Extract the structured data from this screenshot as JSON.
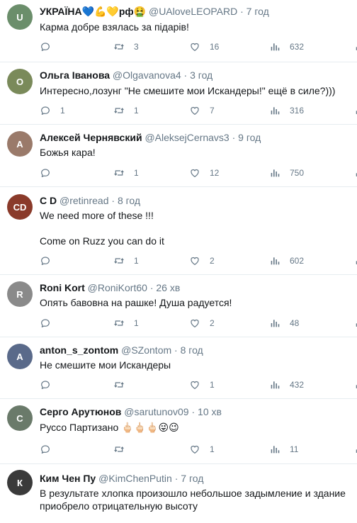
{
  "tweets": [
    {
      "name": "УКРАЇНА💙💪💛рф🤮",
      "handle": "@UAloveLEOPARD",
      "time": "7 год",
      "text": [
        "Карма добре взялась за підарів!"
      ],
      "replies": "",
      "retweets": "3",
      "likes": "16",
      "views": "632",
      "avatar_color": "#6b8e6b"
    },
    {
      "name": "Ольга Іванова",
      "handle": "@Olgavanova4",
      "time": "3 год",
      "text": [
        "Интересно,лозунг \"Не смешите мои Искандеры!\" ещё в силе?)))"
      ],
      "replies": "1",
      "retweets": "1",
      "likes": "7",
      "views": "316",
      "avatar_color": "#7a8a5a"
    },
    {
      "name": "Алексей Чернявский",
      "handle": "@AleksejCernavs3",
      "time": "9 год",
      "text": [
        "Божья кара!"
      ],
      "replies": "",
      "retweets": "1",
      "likes": "12",
      "views": "750",
      "avatar_color": "#9a7a6a"
    },
    {
      "name": "C D",
      "handle": "@retinread",
      "time": "8 год",
      "text": [
        "We need more of these !!!",
        "Come on Ruzz you can do it"
      ],
      "replies": "",
      "retweets": "1",
      "likes": "2",
      "views": "602",
      "avatar_color": "#8a3a2a"
    },
    {
      "name": "Roni Kort",
      "handle": "@RoniKort60",
      "time": "26 хв",
      "text": [
        "Опять бавовна на рашке! Душа радуется!"
      ],
      "replies": "",
      "retweets": "1",
      "likes": "2",
      "views": "48",
      "avatar_color": "#8a8a8a"
    },
    {
      "name": "anton_s_zontom",
      "handle": "@SZontom",
      "time": "8 год",
      "text": [
        "Не смешите мои Искандеры"
      ],
      "replies": "",
      "retweets": "",
      "likes": "1",
      "views": "432",
      "avatar_color": "#5a6a8a"
    },
    {
      "name": "Серго Арутюнов",
      "handle": "@sarutunov09",
      "time": "10 хв",
      "text": [
        "Руссо Партизано 🖕🏻🖕🏻🖕🏻😜😉"
      ],
      "replies": "",
      "retweets": "",
      "likes": "1",
      "views": "11",
      "avatar_color": "#6a7a6a"
    },
    {
      "name": "Ким Чен Пу",
      "handle": "@KimChenPutin",
      "time": "7 год",
      "text": [
        "В результате хлопка произошло небольшое задымление и здание приобрело отрицательную высоту"
      ],
      "replies": "",
      "retweets": "",
      "likes": "",
      "views": "",
      "avatar_color": "#3a3a3a"
    }
  ],
  "icons": {
    "reply": "reply-icon",
    "retweet": "retweet-icon",
    "like": "like-icon",
    "views": "views-icon",
    "share": "share-icon"
  }
}
